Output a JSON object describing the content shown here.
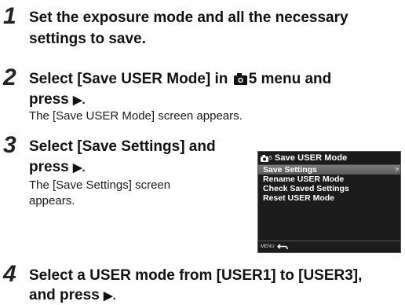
{
  "steps": [
    {
      "number": "1",
      "title_line1": "Set the exposure mode and all the necessary",
      "title_line2": "settings to save."
    },
    {
      "number": "2",
      "title_line1_pre": "Select [Save USER Mode] in ",
      "title_line1_post": "5 menu and",
      "title_line2": "press ",
      "body": "The [Save USER Mode] screen appears."
    },
    {
      "number": "3",
      "title_line1": "Select [Save Settings] and",
      "title_line2": "press ",
      "body_line1": "The [Save Settings] screen",
      "body_line2": "appears."
    },
    {
      "number": "4",
      "title_line1": "Select a USER mode from [USER1] to [USER3],",
      "title_line2": "and press "
    }
  ],
  "arrow": "▶.",
  "lcd": {
    "tab_number": "5",
    "title": "Save USER Mode",
    "items": [
      "Save Settings",
      "Rename USER Mode",
      "Check Saved Settings",
      "Reset USER Mode"
    ],
    "caret": ">",
    "footer_label": "MENU"
  }
}
